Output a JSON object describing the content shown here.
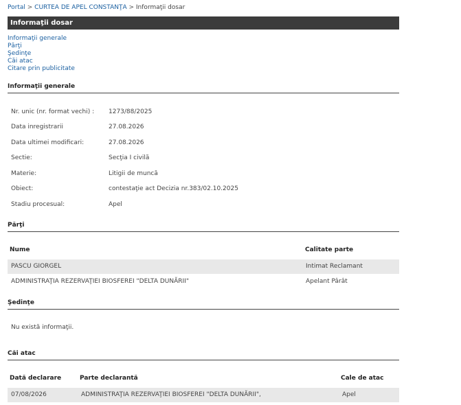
{
  "breadcrumb": {
    "portal": "Portal",
    "sep1": ">",
    "court": "CURTEA DE APEL CONSTANŢA",
    "sep2": ">",
    "current": "Informaţii dosar"
  },
  "title": "Informaţii dosar",
  "subnav": [
    "Informaţii generale",
    "Părţi",
    "Şedinţe",
    "Căi atac",
    "Citare prin publicitate"
  ],
  "general": {
    "heading": "Informaţii generale",
    "rows": [
      {
        "label": "Nr. unic (nr. format vechi) :",
        "value": "1273/88/2025"
      },
      {
        "label": "Data inregistrarii",
        "value": "27.08.2026"
      },
      {
        "label": "Data ultimei modificari:",
        "value": "27.08.2026"
      },
      {
        "label": "Sectie:",
        "value": "Secţia I civilă"
      },
      {
        "label": "Materie:",
        "value": "Litigii de muncă"
      },
      {
        "label": "Obiect:",
        "value": "contestaţie act Decizia nr.383/02.10.2025"
      },
      {
        "label": "Stadiu procesual:",
        "value": "Apel"
      }
    ]
  },
  "parti": {
    "heading": "Părţi",
    "col_name": "Nume",
    "col_role": "Calitate parte",
    "rows": [
      {
        "name": "PASCU GIORGEL",
        "role": "Intimat Reclamant"
      },
      {
        "name": "ADMINISTRAŢIA REZERVAŢIEI BIOSFEREI \"DELTA DUNĂRII\"",
        "role": "Apelant Pârât"
      }
    ]
  },
  "sedinte": {
    "heading": "Şedinţe",
    "empty": "Nu există informaţii."
  },
  "cai_atac": {
    "heading": "Căi atac",
    "col_date": "Dată declarare",
    "col_party": "Parte declarantă",
    "col_type": "Cale de atac",
    "rows": [
      {
        "date": "07/08/2026",
        "party": "ADMINISTRAŢIA REZERVAŢIEI BIOSFEREI \"DELTA DUNĂRII\",",
        "type": "Apel"
      }
    ]
  }
}
